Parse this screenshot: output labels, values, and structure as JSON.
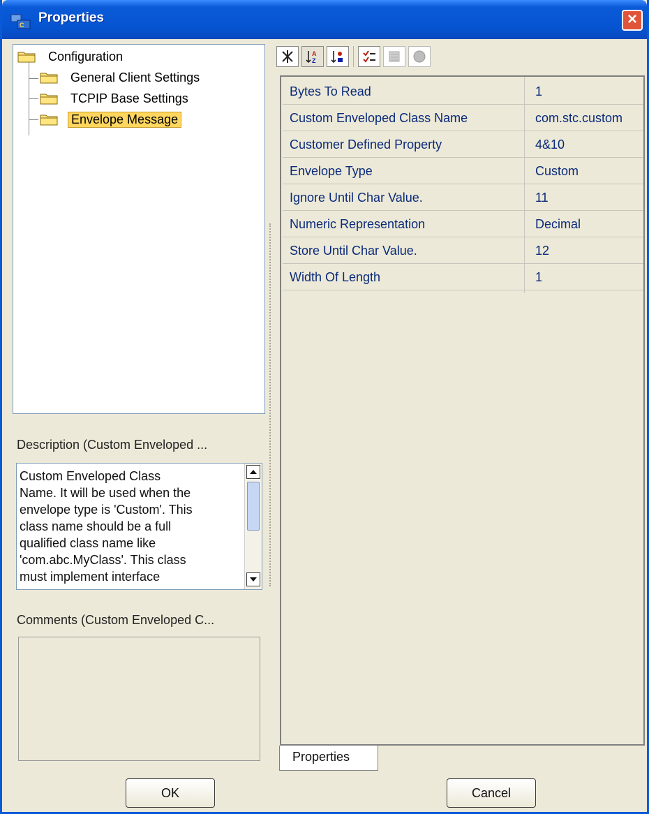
{
  "window": {
    "title": "Properties"
  },
  "tree": {
    "root": "Configuration",
    "items": [
      {
        "label": "General Client Settings"
      },
      {
        "label": "TCPIP Base Settings"
      },
      {
        "label": "Envelope Message",
        "selected": true
      }
    ]
  },
  "description": {
    "label": "Description (Custom Enveloped ...",
    "lines": [
      "Custom Enveloped Class",
      "Name. It will be used when the",
      "envelope type is 'Custom'. This",
      "class name should be a full",
      "qualified class name like",
      "'com.abc.MyClass'. This class",
      "must implement interface"
    ]
  },
  "comments": {
    "label": "Comments (Custom Enveloped C..."
  },
  "toolbar": {
    "icons": [
      "categorized-icon",
      "sort-alphabetic-icon",
      "sort-by-type-icon",
      "edit-list-icon",
      "properties-sheet-icon",
      "help-icon"
    ]
  },
  "properties": [
    {
      "name": "Bytes To Read",
      "value": "1"
    },
    {
      "name": "Custom Enveloped Class Name",
      "value": "com.stc.custom"
    },
    {
      "name": "Customer Defined Property",
      "value": "4&10"
    },
    {
      "name": "Envelope Type",
      "value": "Custom"
    },
    {
      "name": "Ignore Until Char Value.",
      "value": "11"
    },
    {
      "name": "Numeric Representation",
      "value": "Decimal"
    },
    {
      "name": "Store Until Char Value.",
      "value": "12"
    },
    {
      "name": "Width Of Length",
      "value": "1"
    }
  ],
  "tab": {
    "label": "Properties"
  },
  "buttons": {
    "ok": "OK",
    "cancel": "Cancel"
  }
}
